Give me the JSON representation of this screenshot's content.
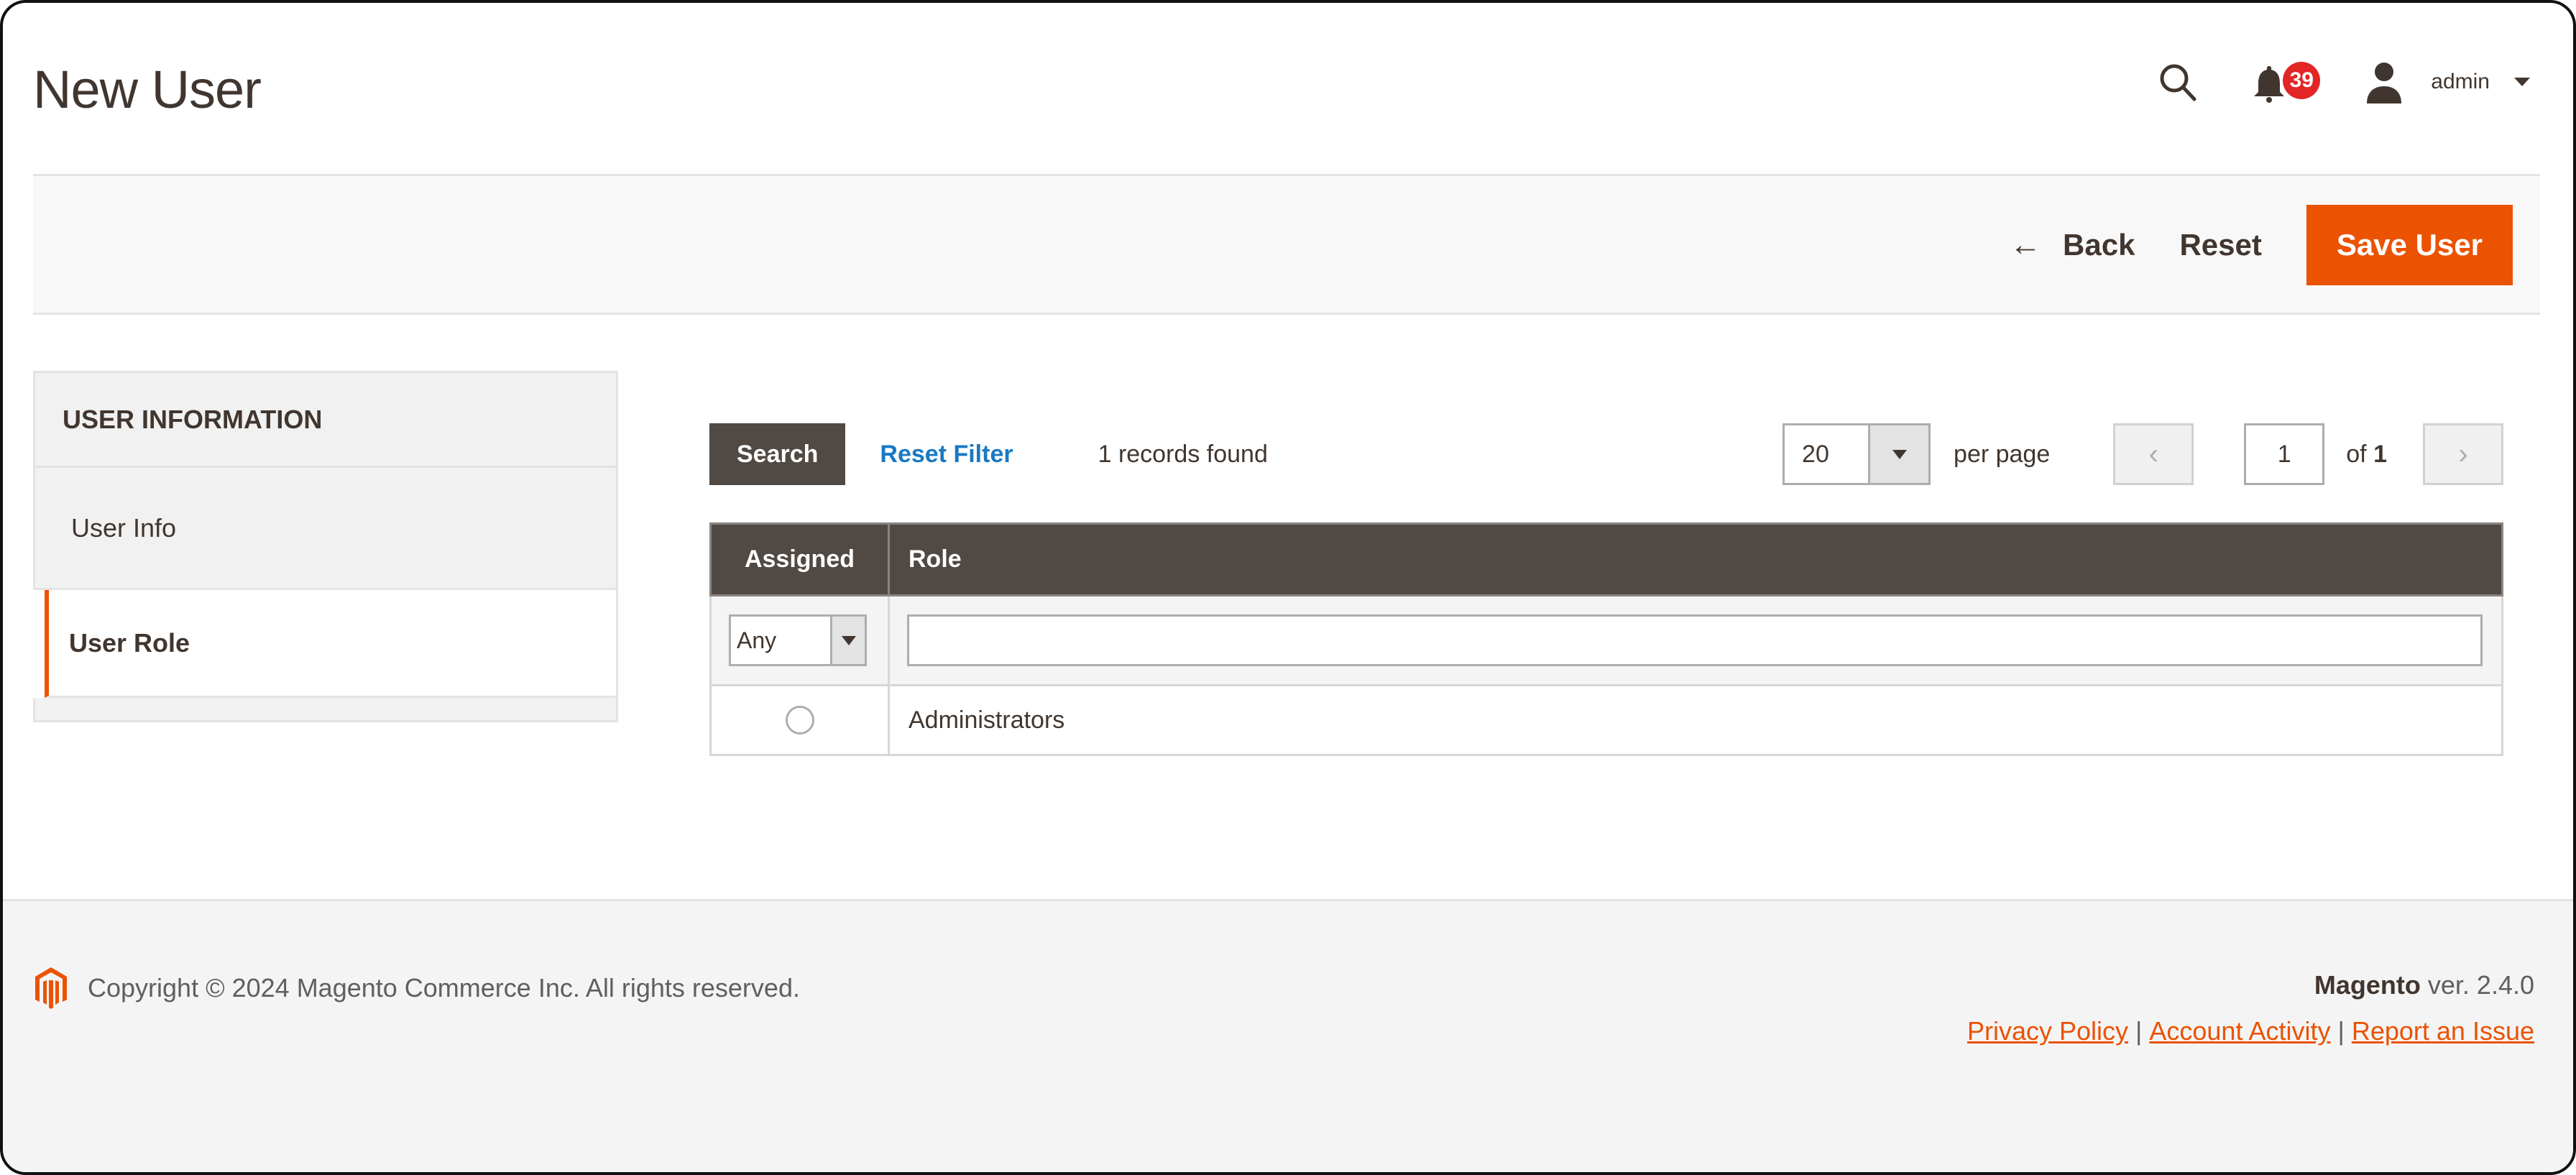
{
  "header": {
    "title": "New User",
    "notification_count": "39",
    "user_name": "admin",
    "icons": {
      "search": "search-icon",
      "notifications": "bell-icon",
      "user": "user-icon",
      "user_menu": "chevron-down-icon"
    }
  },
  "toolbar": {
    "back_label": "Back",
    "back_icon": "←",
    "reset_label": "Reset",
    "save_label": "Save User"
  },
  "sidebar": {
    "title": "USER INFORMATION",
    "items": [
      {
        "label": "User Info",
        "active": false
      },
      {
        "label": "User Role",
        "active": true
      }
    ]
  },
  "grid": {
    "search_label": "Search",
    "reset_filter_label": "Reset Filter",
    "records_found": "1 records found",
    "per_page_value": "20",
    "per_page_label": "per page",
    "current_page": "1",
    "page_of_prefix": "of",
    "total_pages": "1",
    "prev_icon": "‹",
    "next_icon": "›",
    "columns": [
      "Assigned",
      "Role"
    ],
    "filters": {
      "assigned_value": "Any",
      "role_value": ""
    },
    "rows": [
      {
        "assigned": false,
        "role": "Administrators"
      }
    ]
  },
  "footer": {
    "copyright": "Copyright © 2024 Magento Commerce Inc. All rights reserved.",
    "brand": "Magento",
    "version": " ver. 2.4.0",
    "links": [
      "Privacy Policy",
      "Account Activity",
      "Report an Issue"
    ],
    "link_separator": "|"
  },
  "colors": {
    "accent": "#eb5202",
    "header_dark": "#514943",
    "link_blue": "#1979c3",
    "badge_red": "#e22626",
    "text": "#41362f"
  }
}
